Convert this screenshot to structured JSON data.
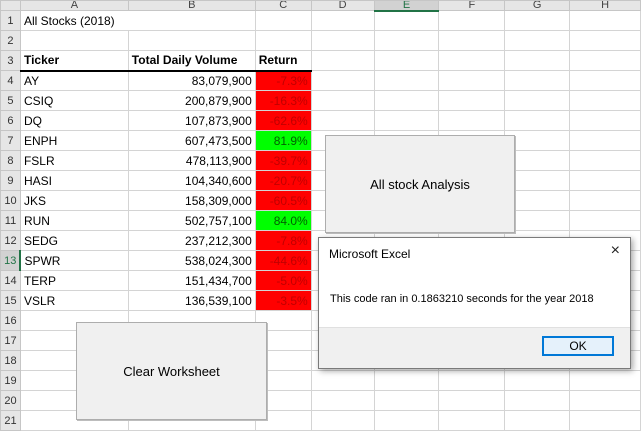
{
  "columns": [
    "A",
    "B",
    "C",
    "D",
    "E",
    "F",
    "G",
    "H"
  ],
  "selected_column": "E",
  "selected_row": "13",
  "rows": [
    {
      "n": "1",
      "a": "All Stocks (2018)",
      "b": "",
      "c": "",
      "kind": "title"
    },
    {
      "n": "2",
      "a": "",
      "b": "",
      "c": "",
      "kind": "blank"
    },
    {
      "n": "3",
      "a": "Ticker",
      "b": "Total Daily Volume",
      "c": "Return",
      "kind": "header"
    },
    {
      "n": "4",
      "a": "AY",
      "b": "83,079,900",
      "c": "-7.3%",
      "kind": "neg"
    },
    {
      "n": "5",
      "a": "CSIQ",
      "b": "200,879,900",
      "c": "-16.3%",
      "kind": "neg"
    },
    {
      "n": "6",
      "a": "DQ",
      "b": "107,873,900",
      "c": "-62.6%",
      "kind": "neg"
    },
    {
      "n": "7",
      "a": "ENPH",
      "b": "607,473,500",
      "c": "81.9%",
      "kind": "pos"
    },
    {
      "n": "8",
      "a": "FSLR",
      "b": "478,113,900",
      "c": "-39.7%",
      "kind": "neg"
    },
    {
      "n": "9",
      "a": "HASI",
      "b": "104,340,600",
      "c": "-20.7%",
      "kind": "neg"
    },
    {
      "n": "10",
      "a": "JKS",
      "b": "158,309,000",
      "c": "-60.5%",
      "kind": "neg"
    },
    {
      "n": "11",
      "a": "RUN",
      "b": "502,757,100",
      "c": "84.0%",
      "kind": "pos"
    },
    {
      "n": "12",
      "a": "SEDG",
      "b": "237,212,300",
      "c": "-7.8%",
      "kind": "neg"
    },
    {
      "n": "13",
      "a": "SPWR",
      "b": "538,024,300",
      "c": "-44.6%",
      "kind": "neg"
    },
    {
      "n": "14",
      "a": "TERP",
      "b": "151,434,700",
      "c": "-5.0%",
      "kind": "neg"
    },
    {
      "n": "15",
      "a": "VSLR",
      "b": "136,539,100",
      "c": "-3.5%",
      "kind": "neg"
    },
    {
      "n": "16",
      "a": "",
      "b": "",
      "c": "",
      "kind": "blank"
    },
    {
      "n": "17",
      "a": "",
      "b": "",
      "c": "",
      "kind": "blank"
    },
    {
      "n": "18",
      "a": "",
      "b": "",
      "c": "",
      "kind": "blank"
    },
    {
      "n": "19",
      "a": "",
      "b": "",
      "c": "",
      "kind": "blank"
    },
    {
      "n": "20",
      "a": "",
      "b": "",
      "c": "",
      "kind": "blank"
    },
    {
      "n": "21",
      "a": "",
      "b": "",
      "c": "",
      "kind": "blank"
    }
  ],
  "buttons": {
    "analysis": "All stock Analysis",
    "clear": "Clear Worksheet"
  },
  "dialog": {
    "title": "Microsoft Excel",
    "message": "This code ran in 0.1863210 seconds for the year 2018",
    "ok_label": "OK",
    "close_icon": "×"
  },
  "colors": {
    "negative_fill": "#ff0000",
    "positive_fill": "#00ff00"
  }
}
